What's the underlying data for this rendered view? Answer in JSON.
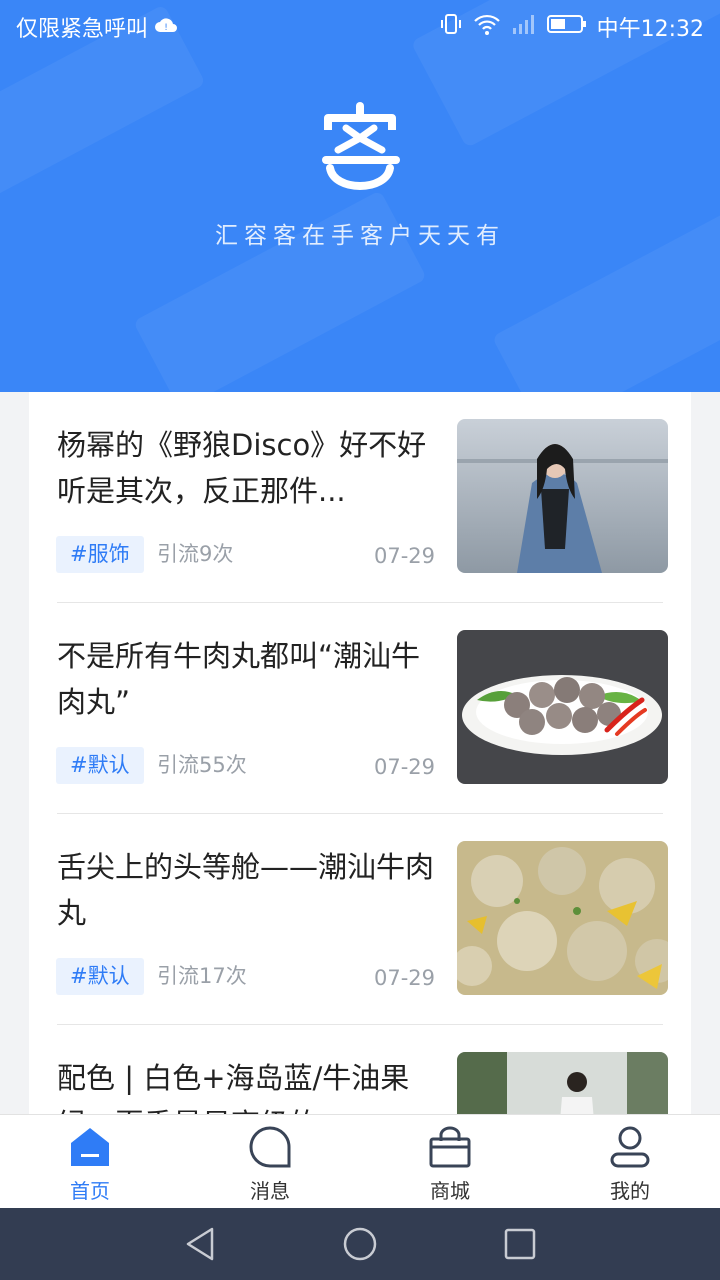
{
  "status_bar": {
    "carrier": "仅限紧急呼叫",
    "time": "中午12:32"
  },
  "header": {
    "logo_char": "客",
    "slogan": "汇容客在手客户天天有"
  },
  "articles": [
    {
      "title": "杨幂的《野狼Disco》好不好听是其次，反正那件...",
      "tag": "#服饰",
      "views": "引流9次",
      "date": "07-29"
    },
    {
      "title": "不是所有牛肉丸都叫“潮汕牛肉丸”",
      "tag": "#默认",
      "views": "引流55次",
      "date": "07-29"
    },
    {
      "title": "舌尖上的头等舱——潮汕牛肉丸",
      "tag": "#默认",
      "views": "引流17次",
      "date": "07-29"
    },
    {
      "title": "配色 | 白色+海岛蓝/牛油果绿，夏季最显高级的",
      "tag": "",
      "views": "",
      "date": ""
    }
  ],
  "tabs": [
    {
      "label": "首页",
      "active": true
    },
    {
      "label": "消息",
      "active": false
    },
    {
      "label": "商城",
      "active": false
    },
    {
      "label": "我的",
      "active": false
    }
  ],
  "colors": {
    "brand_blue": "#3a86f7",
    "tag_text": "#2f7cf6",
    "tag_bg": "#eaf2fe",
    "nav_bar": "#333d52"
  }
}
